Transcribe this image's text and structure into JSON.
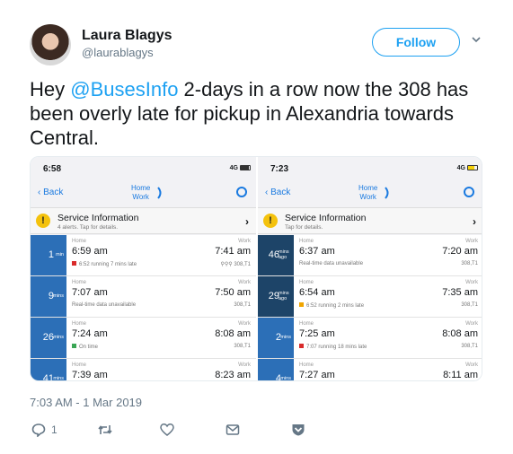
{
  "author": {
    "display_name": "Laura Blagys",
    "handle": "@laurablagys"
  },
  "follow_label": "Follow",
  "tweet": {
    "pre": "Hey ",
    "mention": "@BusesInfo",
    "post": " 2-days in a row now the 308 has been overly late for pickup in Alexandria towards Central."
  },
  "timestamp": "7:03 AM - 1 Mar 2019",
  "actions": {
    "reply_count": "1"
  },
  "phones": [
    {
      "status_time": "6:58",
      "network": "4G",
      "back_label": "Back",
      "route_from": "Home",
      "route_to": "Work",
      "alert_title": "Service Information",
      "alert_sub": "4 alerts. Tap for details.",
      "trips": [
        {
          "mins": "1",
          "unit": "min",
          "home_label": "Home",
          "depart": "6:59 am",
          "status_color": "#d92b2b",
          "note": "6:52 running 7 mins late",
          "work_label": "Work",
          "arrive": "7:41 am",
          "service": "308,T1"
        },
        {
          "mins": "9",
          "unit": "mins",
          "home_label": "Home",
          "depart": "7:07 am",
          "note": "Real-time data unavailable",
          "work_label": "Work",
          "arrive": "7:50 am",
          "service": "308,T1"
        },
        {
          "mins": "26",
          "unit": "mins",
          "home_label": "Home",
          "depart": "7:24 am",
          "status_color": "#3aa655",
          "note": "On time",
          "work_label": "Work",
          "arrive": "8:08 am",
          "service": "308,T1"
        },
        {
          "mins": "41",
          "unit": "mins",
          "home_label": "Home",
          "depart": "7:39 am",
          "note": "",
          "work_label": "Work",
          "arrive": "8:23 am",
          "service": ""
        }
      ]
    },
    {
      "status_time": "7:23",
      "network": "4G",
      "back_label": "Back",
      "route_from": "Home",
      "route_to": "Work",
      "alert_title": "Service Information",
      "alert_sub": "Tap for details.",
      "trips": [
        {
          "mins": "46",
          "unit": "mins ago",
          "home_label": "Home",
          "depart": "6:37 am",
          "note": "Real-time data unavailable",
          "work_label": "Work",
          "arrive": "7:20 am",
          "service": "308,T1"
        },
        {
          "mins": "29",
          "unit": "mins ago",
          "home_label": "Home",
          "depart": "6:54 am",
          "status_color": "#f0a500",
          "note": "6:52 running 2 mins late",
          "work_label": "Work",
          "arrive": "7:35 am",
          "service": "308,T1"
        },
        {
          "mins": "2",
          "unit": "mins",
          "home_label": "Home",
          "depart": "7:25 am",
          "status_color": "#d92b2b",
          "note": "7:07 running 18 mins late",
          "work_label": "Work",
          "arrive": "8:08 am",
          "service": "308,T1"
        },
        {
          "mins": "4",
          "unit": "mins",
          "home_label": "Home",
          "depart": "7:27 am",
          "note": "",
          "work_label": "Work",
          "arrive": "8:11 am",
          "service": ""
        }
      ]
    }
  ],
  "colors": {
    "twitter_blue": "#1da1f2",
    "ios_blue": "#1a7ae0",
    "minutes_bar": "#2c6fb7",
    "minutes_bar_past": "#1d4468",
    "battery_left": "#333333",
    "battery_right": "#f5d10a",
    "alert_yellow": "#f4c20d"
  }
}
